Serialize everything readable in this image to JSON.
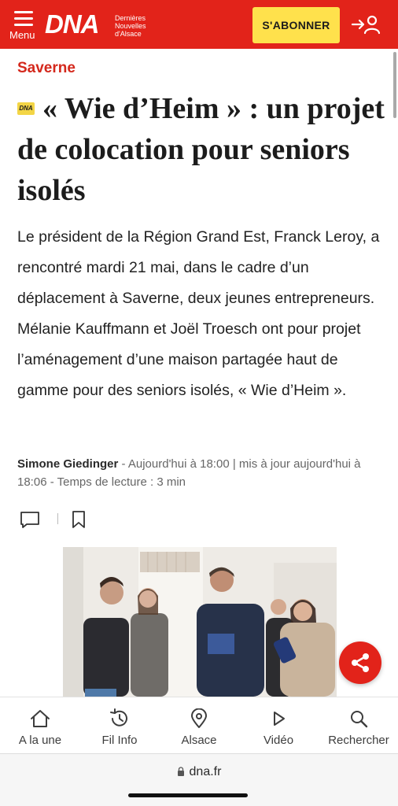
{
  "header": {
    "menu_label": "Menu",
    "logo_text": "DNA",
    "logo_subtitle_1": "Dernières",
    "logo_subtitle_2": "Nouvelles",
    "logo_subtitle_3": "d'Alsace",
    "subscribe_label": "S'ABONNER",
    "login_icon": "login-user-icon",
    "brand_color": "#e2231a",
    "subscribe_color": "#ffe14c"
  },
  "article": {
    "rubric": "Saverne",
    "badge_text": "DNA",
    "title": "« Wie d’Heim » : un projet de colocation pour seniors isolés",
    "lead": "Le président de la Région Grand Est, Franck Leroy, a rencontré mardi 21 mai, dans le cadre d’un déplacement à Saverne, deux jeunes entrepreneurs. Mélanie Kauffmann et Joël Troesch ont pour projet l’aménagement d’une maison partagée haut de gamme pour des seniors isolés, « Wie d’Heim ».",
    "author": "Simone Giedinger",
    "published": " - Aujourd'hui à 18:00 | mis à jour aujourd'hui à 18:06 - Temps de lecture : 3 min"
  },
  "actions": {
    "comment_icon": "comment-icon",
    "bookmark_icon": "bookmark-icon",
    "share_icon": "share-icon"
  },
  "bottom_nav": {
    "items": [
      {
        "label": "A la une",
        "icon": "home-icon"
      },
      {
        "label": "Fil Info",
        "icon": "history-icon"
      },
      {
        "label": "Alsace",
        "icon": "location-pin-icon"
      },
      {
        "label": "Vidéo",
        "icon": "play-icon"
      },
      {
        "label": "Rechercher",
        "icon": "search-icon"
      }
    ]
  },
  "browser": {
    "url": "dna.fr"
  }
}
